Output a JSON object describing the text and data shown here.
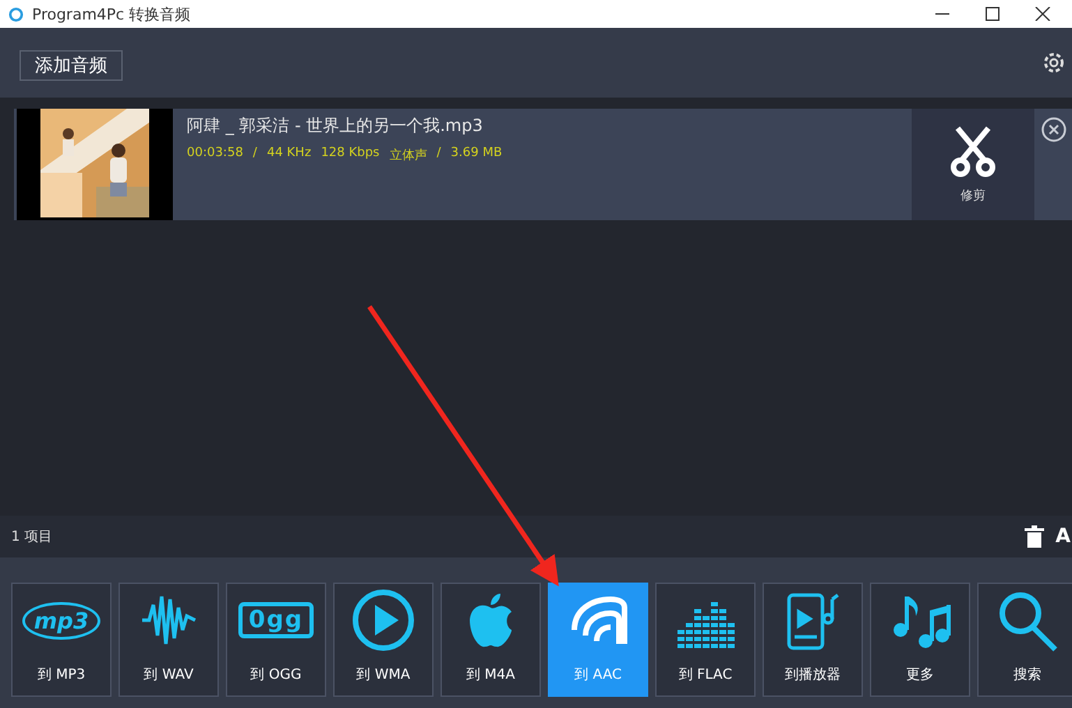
{
  "window": {
    "title": "Program4Pc 转换音频"
  },
  "toolbar": {
    "add_button": "添加音频"
  },
  "files": [
    {
      "name": "阿肆 _ 郭采洁 - 世界上的另一个我.mp3",
      "duration": "00:03:58",
      "separator_1": "/",
      "sample_rate": "44 KHz",
      "bitrate": "128 Kbps",
      "channels": "立体声",
      "separator_2": "/",
      "size": "3.69 MB",
      "trim_label": "修剪"
    }
  ],
  "status_bar": {
    "count": "1 项目",
    "cut_label": "A"
  },
  "formats": [
    {
      "kind": "mp3",
      "label": "到 MP3",
      "logo": "mp3",
      "selected": false
    },
    {
      "kind": "wave",
      "label": "到 WAV",
      "selected": false
    },
    {
      "kind": "ogg",
      "label": "到 OGG",
      "logo": "0gg",
      "selected": false
    },
    {
      "kind": "play",
      "label": "到 WMA",
      "selected": false
    },
    {
      "kind": "apple",
      "label": "到 M4A",
      "selected": false
    },
    {
      "kind": "aac",
      "label": "到 AAC",
      "selected": true
    },
    {
      "kind": "eq",
      "label": "到 FLAC",
      "selected": false
    },
    {
      "kind": "player",
      "label": "到播放器",
      "selected": false
    },
    {
      "kind": "notes",
      "label": "更多",
      "selected": false
    },
    {
      "kind": "search",
      "label": "搜索",
      "selected": false
    }
  ],
  "annotations": [
    {
      "kind": "arrow"
    }
  ]
}
